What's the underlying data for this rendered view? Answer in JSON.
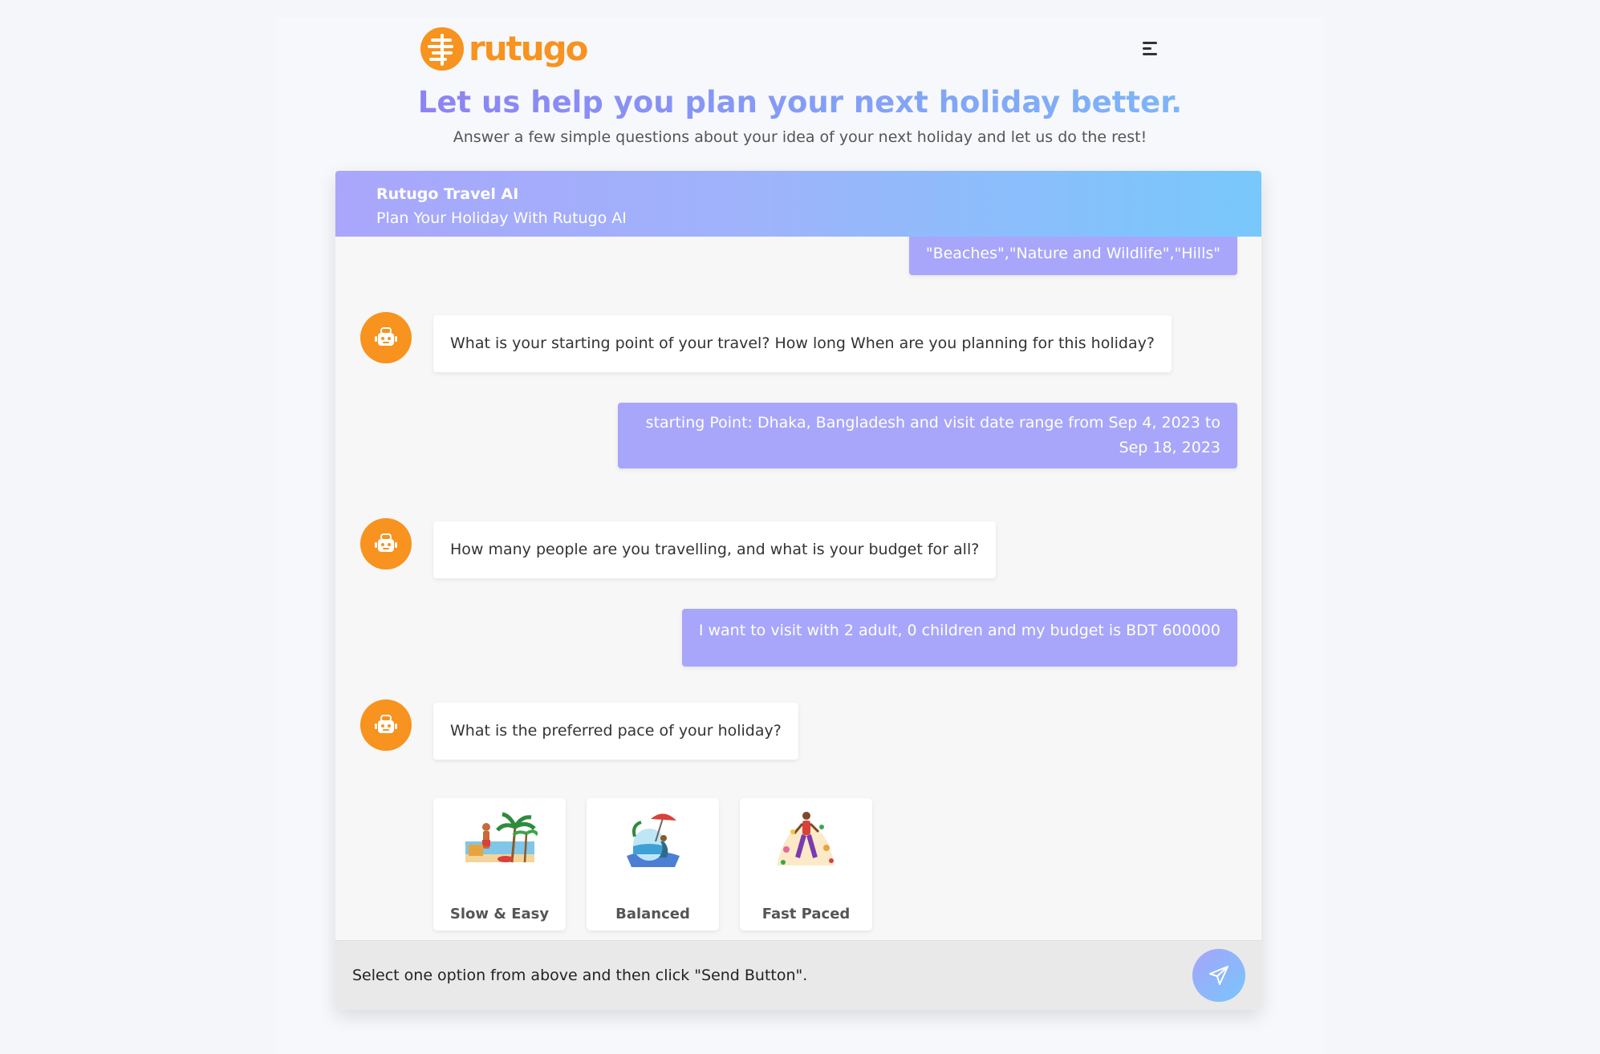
{
  "brand": {
    "name": "rutugo",
    "color": "#f7931e"
  },
  "hero": {
    "headline": "Let us help you plan your next holiday better.",
    "subline": "Answer a few simple questions about your idea of your next holiday and let us do the rest!"
  },
  "chat": {
    "title": "Rutugo Travel AI",
    "subtitle": "Plan Your Holiday With Rutugo AI",
    "messages": [
      {
        "role": "user",
        "text": "\"Beaches\",\"Nature and Wildlife\",\"Hills\""
      },
      {
        "role": "bot",
        "text": "What is your starting point of your travel? How long When are you planning for this holiday?"
      },
      {
        "role": "user",
        "line1": "starting Point: Dhaka, Bangladesh and visit date range from Sep 4, 2023 to",
        "line2": "Sep 18, 2023"
      },
      {
        "role": "bot",
        "text": "How many people are you travelling, and what is your budget for all?"
      },
      {
        "role": "user",
        "text": "I want to visit with 2 adult, 0 children and my budget is BDT 600000"
      },
      {
        "role": "bot",
        "text": "What is the preferred pace of your holiday?"
      }
    ],
    "options": [
      {
        "label": "Slow & Easy",
        "icon": "beach-relax-illustration"
      },
      {
        "label": "Balanced",
        "icon": "beach-umbrella-illustration"
      },
      {
        "label": "Fast Paced",
        "icon": "walking-person-illustration"
      }
    ],
    "composer": {
      "value": "Select one option from above and then click \"Send Button\".",
      "send_icon": "send-icon"
    }
  },
  "colors": {
    "user_bubble": "#a8a6fa",
    "header_start": "#a9a6fb",
    "header_end": "#78c8fc",
    "avatar": "#f7931e"
  }
}
